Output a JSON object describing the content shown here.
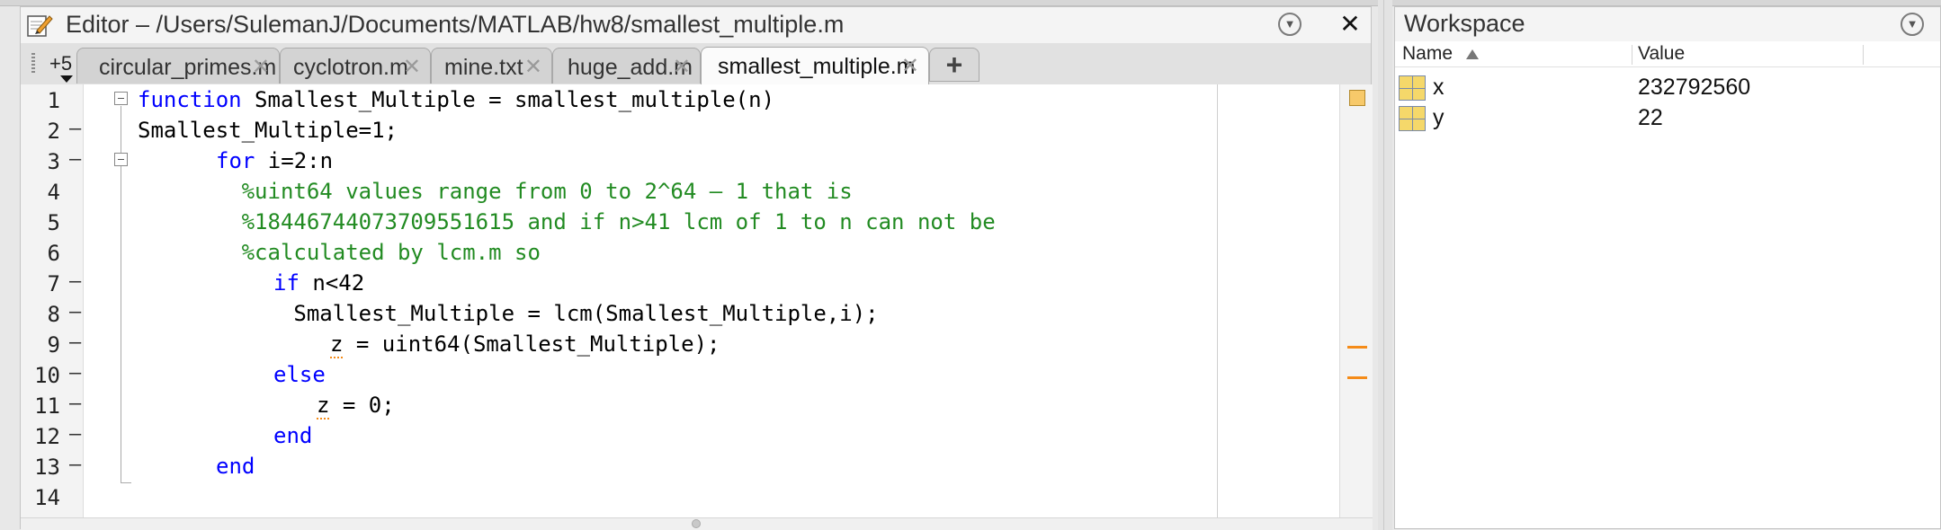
{
  "editor": {
    "title": "Editor – /Users/SulemanJ/Documents/MATLAB/hw8/smallest_multiple.m",
    "overflow_count": "+5",
    "tabs": [
      {
        "label": "circular_primes.m",
        "active": false
      },
      {
        "label": "cyclotron.m",
        "active": false
      },
      {
        "label": "mine.txt",
        "active": false
      },
      {
        "label": "huge_add.m",
        "active": false
      },
      {
        "label": "smallest_multiple.m",
        "active": true
      }
    ],
    "tab_close_glyph": "✕",
    "add_tab_glyph": "+",
    "close_glyph": "✕",
    "menu_glyph": "▼",
    "code_lines": [
      {
        "n": "1",
        "dash": false,
        "text": "function Smallest_Multiple = smallest_multiple(n)"
      },
      {
        "n": "2",
        "dash": true,
        "text": "Smallest_Multiple=1;"
      },
      {
        "n": "3",
        "dash": true,
        "text": "    for i=2:n"
      },
      {
        "n": "4",
        "dash": false,
        "text": "        %uint64 values range from 0 to 2^64 – 1 that is"
      },
      {
        "n": "5",
        "dash": false,
        "text": "        %18446744073709551615 and if n>41 lcm of 1 to n can not be"
      },
      {
        "n": "6",
        "dash": false,
        "text": "        %calculated by lcm.m so"
      },
      {
        "n": "7",
        "dash": true,
        "text": "        if n<42"
      },
      {
        "n": "8",
        "dash": true,
        "text": "            Smallest_Multiple = lcm(Smallest_Multiple,i);"
      },
      {
        "n": "9",
        "dash": true,
        "text": "            z = uint64(Smallest_Multiple);"
      },
      {
        "n": "10",
        "dash": true,
        "text": "        else"
      },
      {
        "n": "11",
        "dash": true,
        "text": "           z = 0;"
      },
      {
        "n": "12",
        "dash": true,
        "text": "        end"
      },
      {
        "n": "13",
        "dash": true,
        "text": "    end"
      },
      {
        "n": "14",
        "dash": false,
        "text": ""
      }
    ],
    "kw_function": "function",
    "l1_rest": " Smallest_Multiple = smallest_multiple(n)",
    "kw_for": "for",
    "l3_rest": " i=2:n",
    "kw_if": "if",
    "l7_rest": " n<42",
    "l9_var": "z",
    "l9_rest": " = uint64(Smallest_Multiple);",
    "l11_var": "z",
    "l11_rest": " = 0;",
    "kw_else": "else",
    "kw_end": "end",
    "dash_glyph": "–"
  },
  "workspace": {
    "title": "Workspace",
    "menu_glyph": "▼",
    "col_name": "Name",
    "col_value": "Value",
    "variables": [
      {
        "name": "x",
        "value": "232792560"
      },
      {
        "name": "y",
        "value": "22"
      }
    ]
  }
}
